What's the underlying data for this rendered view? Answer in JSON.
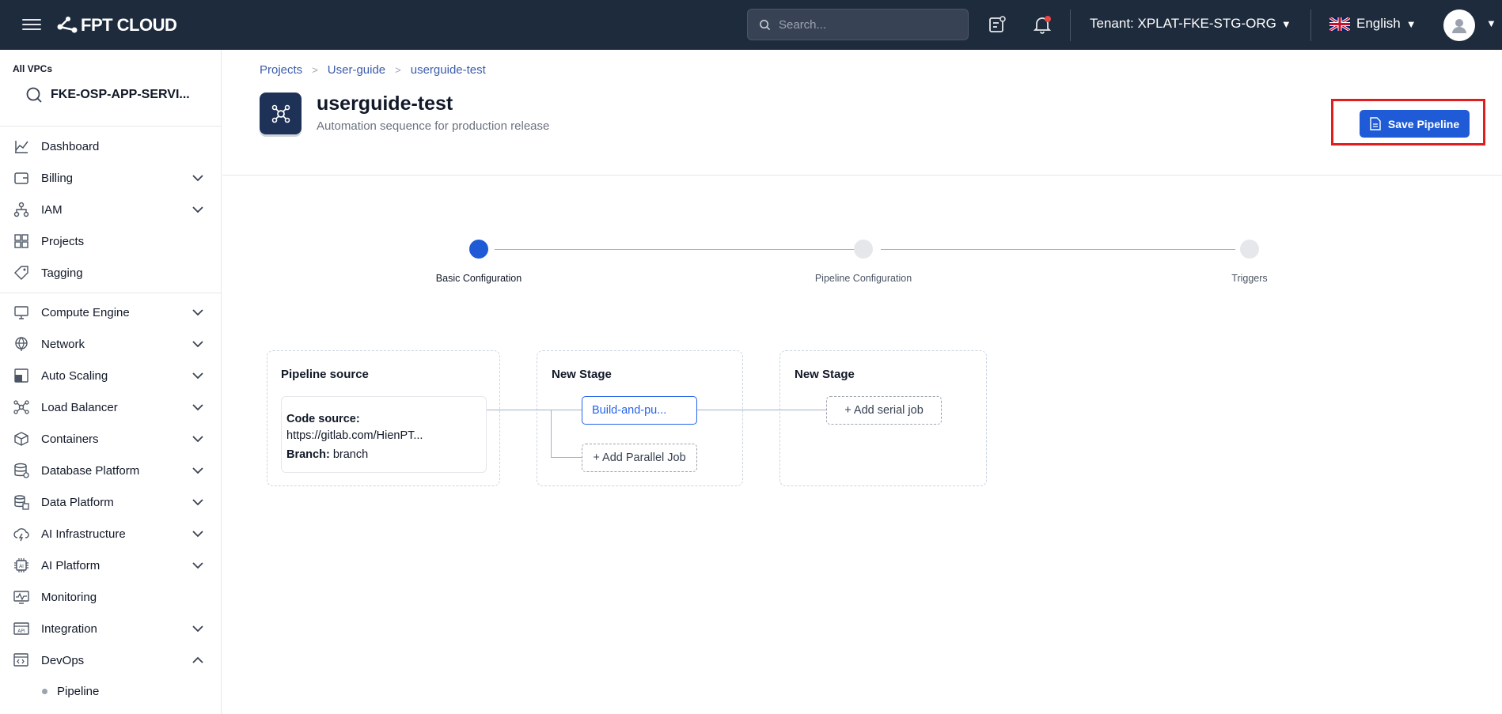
{
  "header": {
    "logo_text": "FPT CLOUD",
    "search_placeholder": "Search...",
    "tenant_label": "Tenant:",
    "tenant_value": "XPLAT-FKE-STG-ORG",
    "language": "English"
  },
  "sidebar": {
    "vpc_label": "All VPCs",
    "vpc_value": "FKE-OSP-APP-SERVI...",
    "items": [
      {
        "label": "Dashboard",
        "icon": "chart-line-icon"
      },
      {
        "label": "Billing",
        "icon": "wallet-icon"
      },
      {
        "label": "IAM",
        "icon": "org-chart-icon"
      },
      {
        "label": "Projects",
        "icon": "grid-icon"
      },
      {
        "label": "Tagging",
        "icon": "tag-icon"
      },
      {
        "label": "Compute Engine",
        "icon": "monitor-icon"
      },
      {
        "label": "Network",
        "icon": "globe-icon"
      },
      {
        "label": "Auto Scaling",
        "icon": "scaling-icon"
      },
      {
        "label": "Load Balancer",
        "icon": "nodes-icon"
      },
      {
        "label": "Containers",
        "icon": "cube-icon"
      },
      {
        "label": "Database Platform",
        "icon": "database-icon"
      },
      {
        "label": "Data Platform",
        "icon": "data-stack-icon"
      },
      {
        "label": "AI Infrastructure",
        "icon": "cloud-bolt-icon"
      },
      {
        "label": "AI Platform",
        "icon": "ai-chip-icon"
      },
      {
        "label": "Monitoring",
        "icon": "pulse-monitor-icon"
      },
      {
        "label": "Integration",
        "icon": "api-icon"
      },
      {
        "label": "DevOps",
        "icon": "code-window-icon"
      }
    ],
    "sub_items": [
      {
        "label": "Pipeline"
      }
    ]
  },
  "breadcrumb": [
    "Projects",
    "User-guide",
    "userguide-test"
  ],
  "project": {
    "title": "userguide-test",
    "subtitle": "Automation sequence for production release"
  },
  "save_label": "Save Pipeline",
  "steps": [
    {
      "label": "Basic Configuration",
      "active": true
    },
    {
      "label": "Pipeline Configuration",
      "active": false
    },
    {
      "label": "Triggers",
      "active": false
    }
  ],
  "pipeline": {
    "source_title": "Pipeline source",
    "code_source_label": "Code source:",
    "code_source_value": "https://gitlab.com/HienPT...",
    "branch_label": "Branch:",
    "branch_value": "branch",
    "stage1_title": "New Stage",
    "stage1_job": "Build-and-pu...",
    "add_parallel": "+ Add Parallel Job",
    "stage2_title": "New Stage",
    "add_serial": "+ Add serial job"
  },
  "colors": {
    "topbar": "#1e2b3c",
    "accent": "#1f5bd6",
    "highlight_frame": "#e11d1d"
  }
}
